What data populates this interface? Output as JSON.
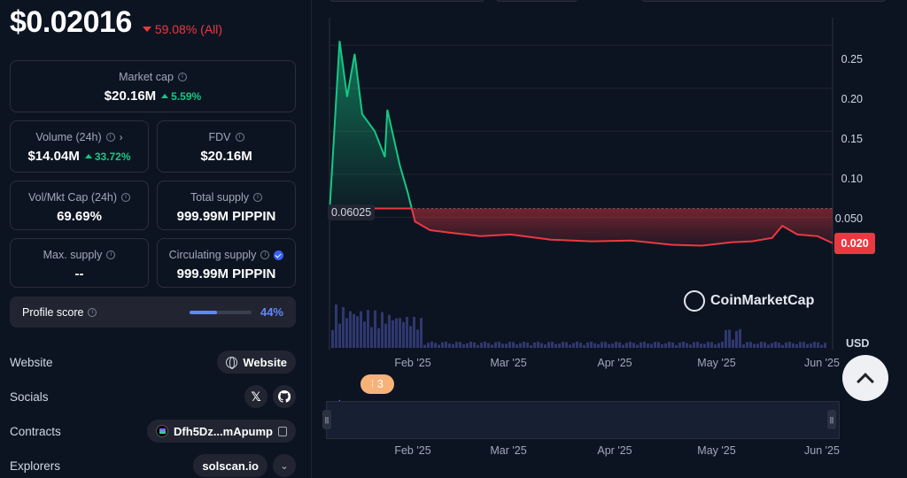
{
  "header": {
    "price": "$0.02016",
    "change": "59.08% (All)"
  },
  "stats": {
    "market_cap": {
      "label": "Market cap",
      "value": "$20.16M",
      "change": "5.59%"
    },
    "volume": {
      "label": "Volume (24h)",
      "value": "$14.04M",
      "change": "33.72%"
    },
    "fdv": {
      "label": "FDV",
      "value": "$20.16M"
    },
    "vol_mkt": {
      "label": "Vol/Mkt Cap (24h)",
      "value": "69.69%"
    },
    "total_supply": {
      "label": "Total supply",
      "value": "999.99M PIPPIN"
    },
    "max_supply": {
      "label": "Max. supply",
      "value": "--"
    },
    "circ_supply": {
      "label": "Circulating supply",
      "value": "999.99M PIPPIN"
    }
  },
  "profile": {
    "label": "Profile score",
    "value": "44%",
    "fraction": 0.44
  },
  "links": {
    "website_label": "Website",
    "website_button": "Website",
    "socials_label": "Socials",
    "contracts_label": "Contracts",
    "contract_value": "Dfh5Dz...mApump",
    "explorers_label": "Explorers",
    "explorer_value": "solscan.io"
  },
  "chart": {
    "y_ticks": [
      "0.25",
      "0.20",
      "0.15",
      "0.10",
      "0.050"
    ],
    "x_ticks": [
      "Feb '25",
      "Mar '25",
      "Apr '25",
      "May '25",
      "Jun '25"
    ],
    "ref_value": "0.06025",
    "current_value": "0.020",
    "currency": "USD",
    "watermark": "CoinMarketCap",
    "event_count": "3",
    "colors": {
      "up": "#16c784",
      "down": "#ea3943",
      "accent": "#6188ff"
    }
  },
  "chart_data": {
    "type": "area",
    "x": [
      "Jan 19",
      "Jan 20",
      "Jan 21",
      "Jan 22",
      "Jan 23",
      "Jan 25",
      "Jan 27",
      "Jan 29",
      "Jan 31",
      "Feb 2",
      "Feb 4",
      "Feb 7",
      "Feb 10",
      "Feb 15",
      "Feb 20",
      "Mar 1",
      "Mar 10",
      "Mar 20",
      "Apr 1",
      "Apr 10",
      "Apr 20",
      "May 1",
      "May 10",
      "May 15",
      "May 20",
      "Jun 1",
      "Jun 5"
    ],
    "series": [
      {
        "values": [
          0.055,
          0.255,
          0.19,
          0.24,
          0.17,
          0.15,
          0.12,
          0.175,
          0.11,
          0.08,
          0.045,
          0.035,
          0.032,
          0.028,
          0.03,
          0.024,
          0.022,
          0.023,
          0.018,
          0.017,
          0.021,
          0.022,
          0.026,
          0.04,
          0.03,
          0.028,
          0.02
        ]
      }
    ],
    "baseline": 0.06025,
    "ylim": [
      0,
      0.28
    ],
    "ylabel": "USD"
  }
}
